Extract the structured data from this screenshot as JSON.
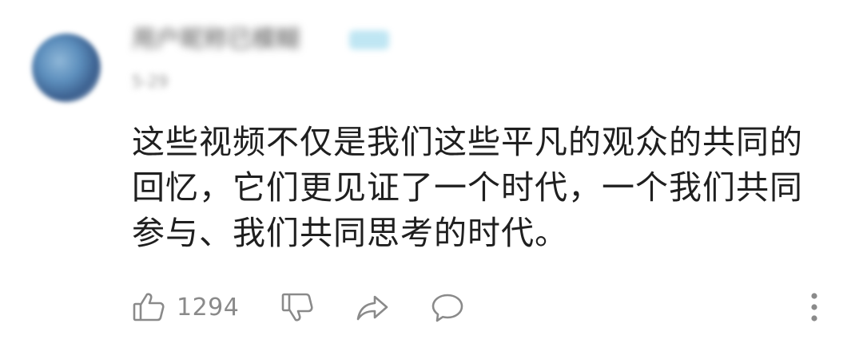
{
  "comment": {
    "username": "用户昵称已模糊",
    "timestamp": "5-29",
    "text": "这些视频不仅是我们这些平凡的观众的共同的回忆，它们更见证了一个时代，一个我们共同参与、我们共同思考的时代。",
    "like_count": "1294"
  },
  "icons": {
    "like": "thumbs-up-icon",
    "dislike": "thumbs-down-icon",
    "share": "share-icon",
    "reply": "comment-icon",
    "more": "more-vertical-icon"
  },
  "colors": {
    "text": "#1f1f1f",
    "icon": "#8a8a8a",
    "badge": "#bfe6f3"
  }
}
